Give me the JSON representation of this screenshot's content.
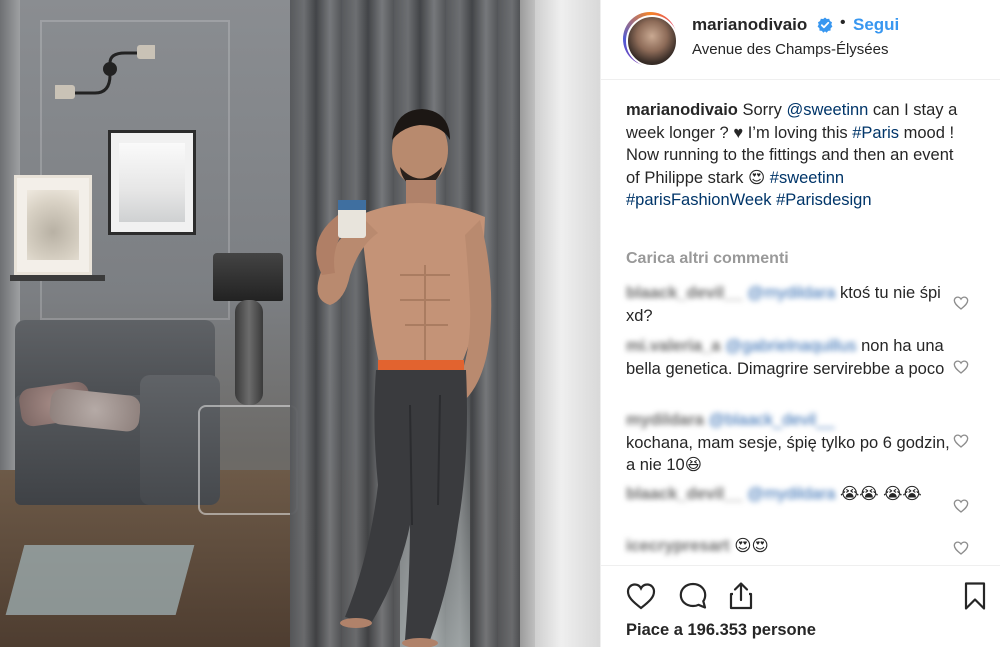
{
  "post": {
    "image_alt": "Photo by marianodivaio"
  },
  "header": {
    "username": "marianodivaio",
    "separator": "•",
    "follow_label": "Segui",
    "location": "Avenue des Champs-Élysées"
  },
  "caption": {
    "username": "marianodivaio",
    "t1": " Sorry ",
    "mention": "@sweetinn",
    "t2": " can I stay a week longer ? ♥ I’m loving this ",
    "tag_paris": "#Paris",
    "t3": " mood ! Now running to the fittings and then an event of Philippe stark 😍",
    "tag_sweetinn": "#sweetinn",
    "tag_fashionweek": "#parisFashionWeek",
    "tag_parisdesign": "#Parisdesign"
  },
  "load_more": "Carica altri commenti",
  "comments": [
    {
      "user": "blaack_devil__",
      "mention": "@mydildara",
      "text": " ktoś tu nie śpi xd?"
    },
    {
      "user": "mi.valeria_a",
      "mention": "@gabrielnaquillus",
      "text": " non ha una bella genetica. Dimagrire servirebbe a poco"
    },
    {
      "user": "mydildara",
      "mention": "@blaack_devil__",
      "text": "kochana, mam sesje, śpię tylko po 6 godzin, a nie 10😆"
    },
    {
      "user": "blaack_devil__",
      "mention": "@mydildara",
      "text": " 😭😭 😭😭"
    },
    {
      "user": "icecrypresart",
      "mention": "",
      "text": " 😍😍"
    }
  ],
  "likes": {
    "label": "Piace a 196.353 persone"
  },
  "colors": {
    "follow": "#3897f0",
    "hashtag": "#003569",
    "muted": "#999999",
    "verified": "#3897f0"
  },
  "icons": [
    "verified-badge-icon",
    "heart-icon",
    "comment-icon",
    "share-icon",
    "bookmark-icon"
  ]
}
